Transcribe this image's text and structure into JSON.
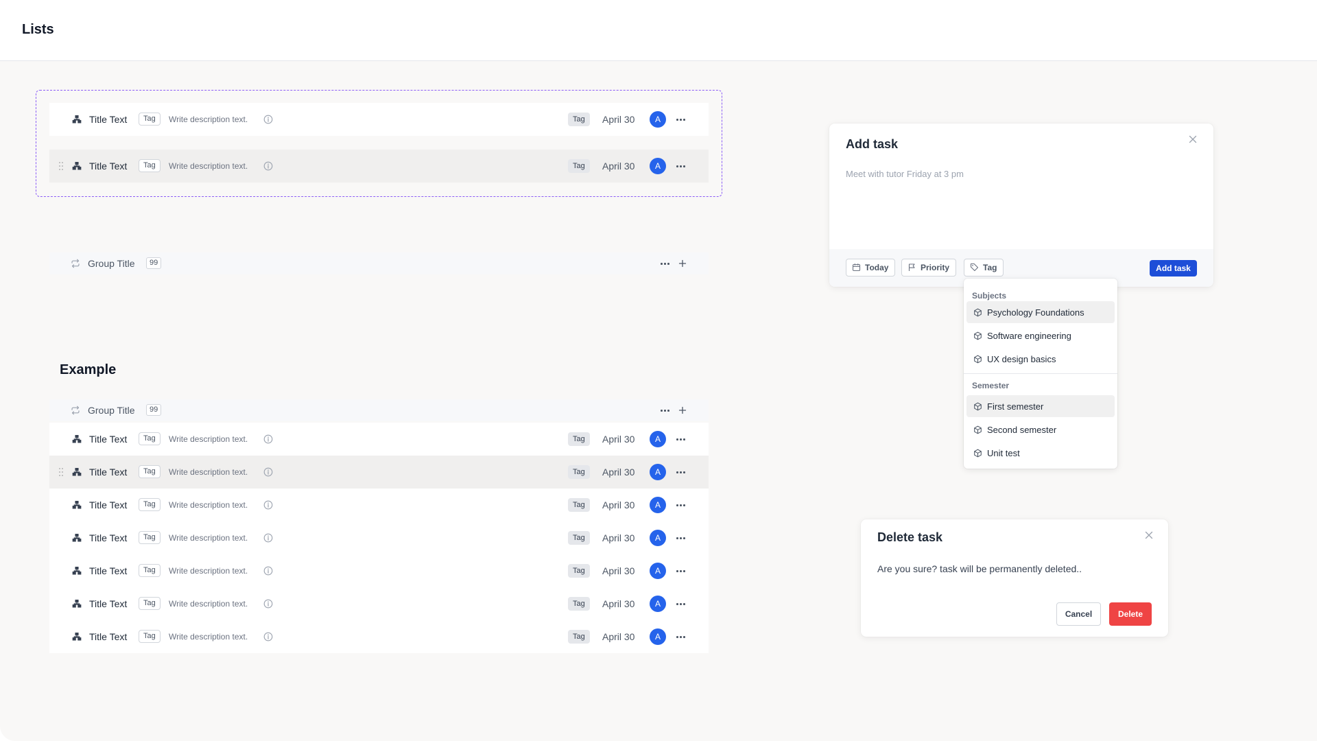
{
  "page": {
    "title": "Lists",
    "example_title": "Example"
  },
  "colors": {
    "accent": "#2563eb",
    "danger": "#ef4444",
    "frame": "#8b5cf6"
  },
  "row": {
    "title": "Title Text",
    "tag": "Tag",
    "description": "Write description text.",
    "badge": "Tag",
    "date": "April 30",
    "avatar": "A",
    "type_icon": "hierarchy-icon",
    "info_icon": "info-icon",
    "more_icon": "more-horizontal-icon"
  },
  "group": {
    "title": "Group Title",
    "count": "99",
    "icon": "repeat-icon"
  },
  "add_task": {
    "title": "Add task",
    "placeholder": "Meet with tutor Friday at 3 pm",
    "chips": {
      "today": "Today",
      "priority": "Priority",
      "tag": "Tag"
    },
    "submit_label": "Add task"
  },
  "tag_dropdown": {
    "groups": [
      {
        "header": "Subjects",
        "items": [
          "Psychology Foundations",
          "Software engineering",
          "UX design basics"
        ]
      },
      {
        "header": "Semester",
        "items": [
          "First semester",
          "Second semester",
          "Unit test"
        ]
      }
    ]
  },
  "delete_task": {
    "title": "Delete task",
    "message": "Are you sure? task will be permanently deleted..",
    "cancel_label": "Cancel",
    "delete_label": "Delete"
  }
}
